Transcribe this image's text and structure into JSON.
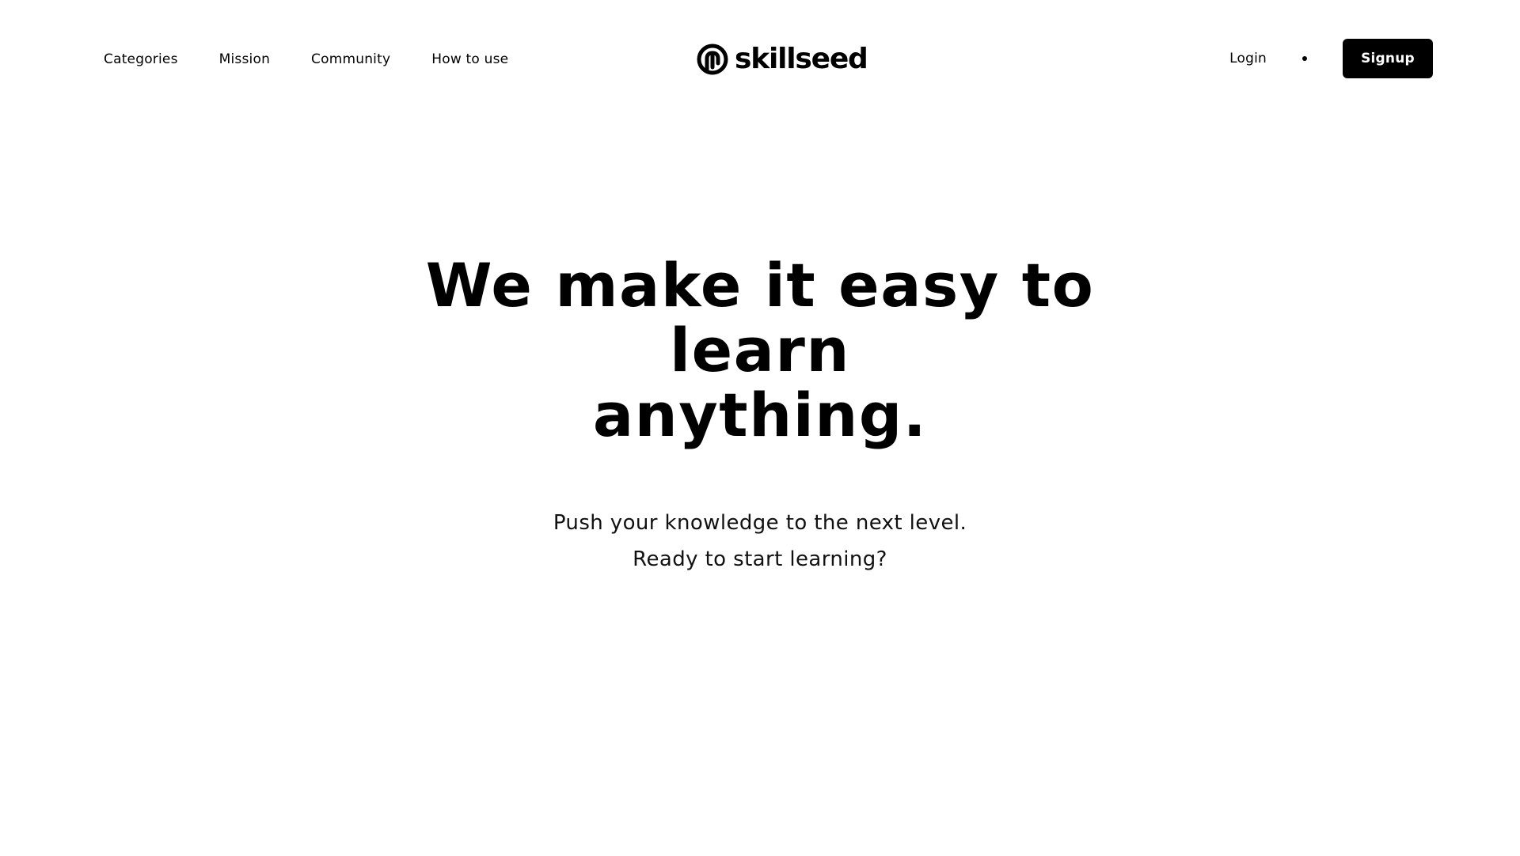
{
  "nav": {
    "links": [
      {
        "label": "Categories"
      },
      {
        "label": "Mission"
      },
      {
        "label": "Community"
      },
      {
        "label": "How to use"
      }
    ],
    "logo_text": "skillseed",
    "logo_icon": "seed-logo-icon",
    "login_label": "Login",
    "signup_label": "Signup"
  },
  "hero": {
    "title_line1": "We make it easy to learn",
    "title_line2": "anything.",
    "subtitle_line1": "Push your knowledge to the next level.",
    "subtitle_line2": "Ready to start learning?"
  },
  "colors": {
    "background": "#ffffff",
    "text": "#000000",
    "button_bg": "#000000",
    "button_text": "#ffffff"
  }
}
